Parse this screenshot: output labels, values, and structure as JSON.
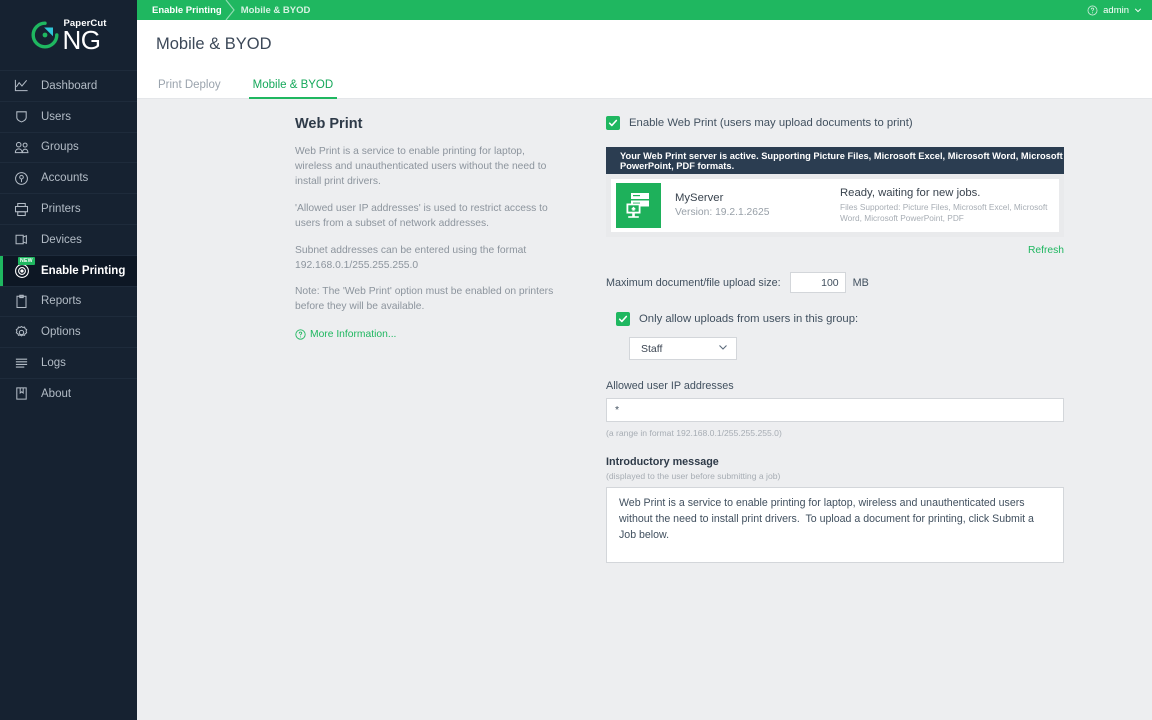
{
  "brand": {
    "name_top": "PaperCut",
    "name_main": "NG",
    "accent": "#1fb760"
  },
  "sidebar": {
    "items": [
      {
        "label": "Dashboard",
        "icon": "chart-line-icon",
        "active": false,
        "badge": ""
      },
      {
        "label": "Users",
        "icon": "shield-icon",
        "active": false,
        "badge": ""
      },
      {
        "label": "Groups",
        "icon": "people-icon",
        "active": false,
        "badge": ""
      },
      {
        "label": "Accounts",
        "icon": "coin-icon",
        "active": false,
        "badge": ""
      },
      {
        "label": "Printers",
        "icon": "printer-icon",
        "active": false,
        "badge": ""
      },
      {
        "label": "Devices",
        "icon": "device-icon",
        "active": false,
        "badge": ""
      },
      {
        "label": "Enable Printing",
        "icon": "target-icon",
        "active": true,
        "badge": "NEW"
      },
      {
        "label": "Reports",
        "icon": "clipboard-icon",
        "active": false,
        "badge": ""
      },
      {
        "label": "Options",
        "icon": "gear-icon",
        "active": false,
        "badge": ""
      },
      {
        "label": "Logs",
        "icon": "lines-icon",
        "active": false,
        "badge": ""
      },
      {
        "label": "About",
        "icon": "book-icon",
        "active": false,
        "badge": ""
      }
    ]
  },
  "topbar": {
    "breadcrumb_1": "Enable Printing",
    "breadcrumb_2": "Mobile & BYOD",
    "user": "admin"
  },
  "page": {
    "title": "Mobile & BYOD",
    "tabs": [
      {
        "label": "Print Deploy",
        "active": false
      },
      {
        "label": "Mobile & BYOD",
        "active": true
      }
    ]
  },
  "left_panel": {
    "heading": "Web Print",
    "paragraphs": [
      "Web Print is a service to enable printing for laptop, wireless and unauthenticated users without the need to install print drivers.",
      "'Allowed user IP addresses' is used to restrict access to users from a subset of network addresses.",
      "Subnet addresses can be entered using the format 192.168.0.1/255.255.255.0",
      "Note: The 'Web Print' option must be enabled on printers before they will be available."
    ],
    "more_info": "More Information..."
  },
  "form": {
    "enable_checkbox_label": "Enable Web Print (users may upload documents to print)",
    "enable_checkbox_checked": true,
    "status_banner": "Your Web Print server is active. Supporting Picture Files, Microsoft Excel, Microsoft Word, Microsoft PowerPoint, PDF formats.",
    "server": {
      "name": "MyServer",
      "version": "Version: 19.2.1.2625",
      "status": "Ready, waiting for new jobs.",
      "files_supported": "Files Supported: Picture Files, Microsoft Excel, Microsoft Word, Microsoft PowerPoint, PDF"
    },
    "refresh_label": "Refresh",
    "max_size_label": "Maximum document/file upload size:",
    "max_size_value": "100",
    "max_size_unit": "MB",
    "group_checkbox_label": "Only allow uploads from users in this group:",
    "group_checkbox_checked": true,
    "group_selected": "Staff",
    "ip_label": "Allowed user IP addresses",
    "ip_value": "*",
    "ip_hint": "(a range in format 192.168.0.1/255.255.255.0)",
    "intro_label": "Introductory message",
    "intro_hint": "(displayed to the user before submitting a job)",
    "intro_value": "Web Print is a service to enable printing for laptop, wireless and unauthenticated users without the need to install print drivers.  To upload a document for printing, click Submit a Job below."
  }
}
